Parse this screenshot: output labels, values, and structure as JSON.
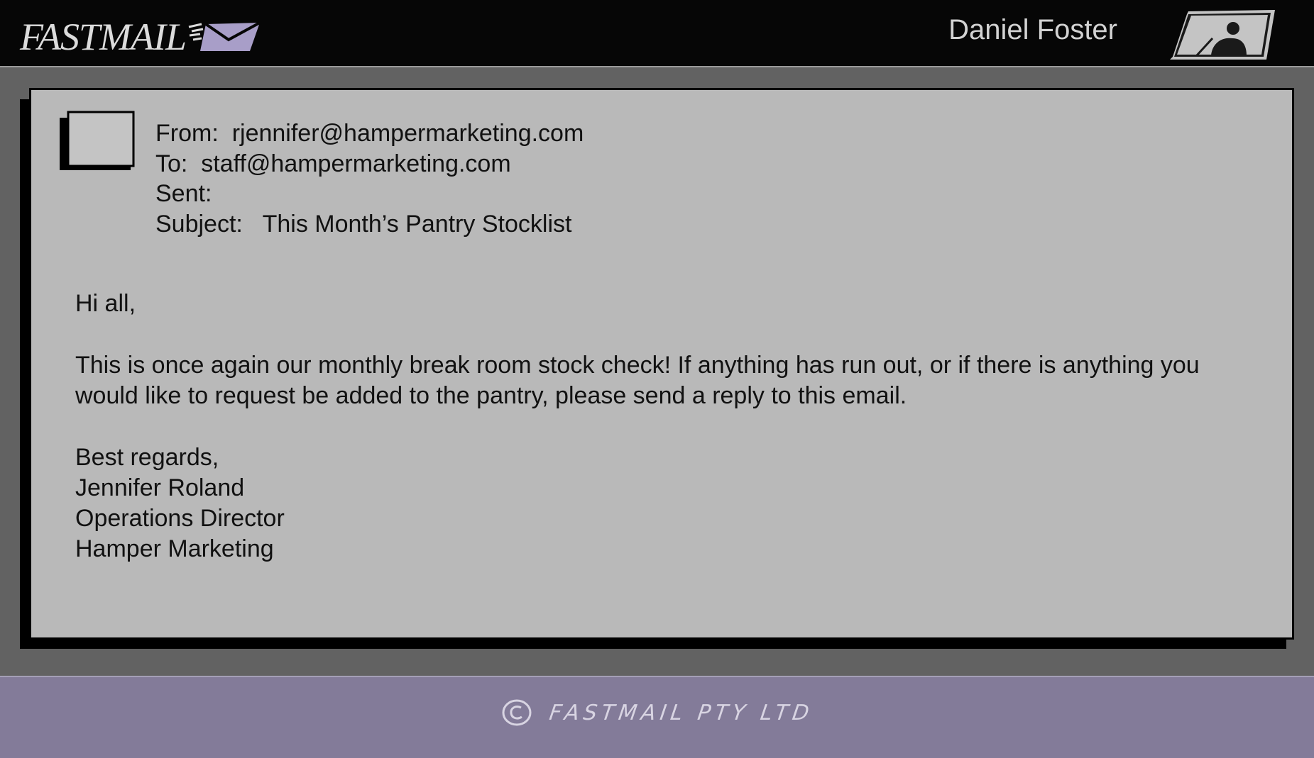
{
  "header": {
    "logo_text": "FASTMAIL",
    "logo_icon": "envelope-icon",
    "user_name": "Daniel Foster",
    "avatar_icon": "user-avatar-icon"
  },
  "email": {
    "sender_avatar_icon": "sender-avatar-icon",
    "from_label": "From:",
    "from_value": "rjennifer@hampermarketing.com",
    "to_label": "To:",
    "to_value": "staff@hampermarketing.com",
    "sent_label": "Sent:",
    "sent_value": "",
    "subject_label": "Subject:",
    "subject_value": "This Month’s Pantry Stocklist",
    "greeting": "Hi all,",
    "paragraph": "This is once again our monthly break room stock check! If anything has run out, or if there is anything you would like to request be added to the pantry, please send a reply to this email.",
    "signoff": "Best regards,",
    "signature": [
      "Jennifer Roland",
      "Operations Director",
      "Hamper Marketing"
    ]
  },
  "footer": {
    "copyright_icon": "copyright-icon",
    "copyright_text": "FASTMAIL PTY LTD"
  },
  "colors": {
    "header_bg": "#060606",
    "page_bg": "#626262",
    "panel_bg": "#b9b9b9",
    "footer_bg": "#837b99",
    "accent_purple": "#a89ec8"
  }
}
